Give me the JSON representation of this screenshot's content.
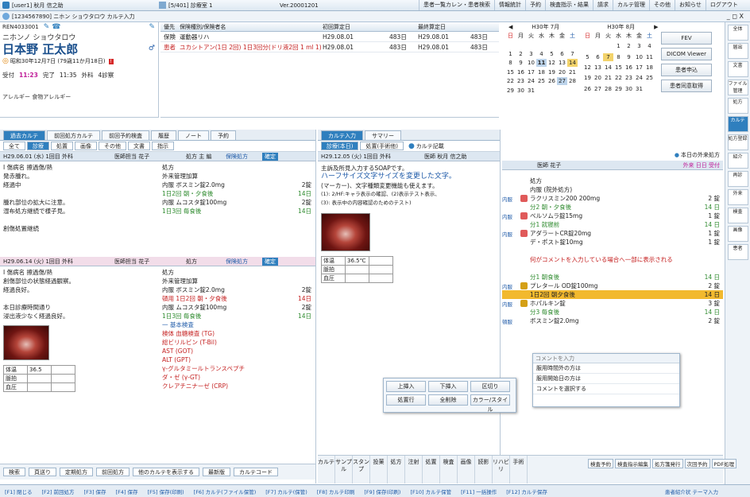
{
  "topbar": {
    "user": "[user1] 秋月 信之助",
    "dept": "[5/401] 診療室 1",
    "version": "Ver.20001201",
    "buttons": [
      "患者一覧カレン・患者検索",
      "情報統計",
      "予約",
      "検査指示・結果",
      "請求",
      "カルテ管理",
      "その他",
      "お知らせ",
      "ログアウト"
    ]
  },
  "subbar": {
    "patient_tab": "[1234567890] ニホン ショウタロウ カルテ入力",
    "win": "_ ◻ X"
  },
  "patient": {
    "id": "REN4033001",
    "kana": "ニホンノ ショウタロウ",
    "name": "日本野 正太郎",
    "birth": "昭和30年12月7日 (79歳11か月18日)",
    "visit_label": "受付",
    "visit_time": "11:23",
    "done_label": "完了",
    "done_time": "11:35",
    "dept_label": "外科",
    "dept_val": "4診察",
    "allergy": "アレルギー 食物アレルギー"
  },
  "insurance": {
    "headers": [
      "優先",
      "保険種別/保険者名",
      "初回算定日",
      "最終算定日"
    ],
    "rows": [
      {
        "type": "保険",
        "name": "運動器リハ",
        "start": "H29.08.01",
        "amt1": "483日",
        "end": "H29.08.01",
        "amt2": "483日"
      },
      {
        "type": "患者",
        "name": "ユカシトアン(1日 2回)  1日3回分(ドリ液2回 1 ml 1)",
        "start": "H29.08.01",
        "amt1": "483日",
        "end": "H29.08.01",
        "amt2": "483日"
      }
    ]
  },
  "calendar": {
    "month1": "H30年 7月",
    "month2": "H30年 8月",
    "weekdays": [
      "日",
      "月",
      "火",
      "水",
      "木",
      "金",
      "土"
    ],
    "days1": [
      "",
      "",
      "",
      "",
      "",
      "",
      "",
      "1",
      "2",
      "3",
      "4",
      "5",
      "6",
      "7",
      "8",
      "9",
      "10",
      "11",
      "12",
      "13",
      "14",
      "15",
      "16",
      "17",
      "18",
      "19",
      "20",
      "21",
      "22",
      "23",
      "24",
      "25",
      "26",
      "27",
      "28",
      "29",
      "30",
      "31"
    ],
    "days2": [
      "",
      "",
      "",
      "1",
      "2",
      "3",
      "4",
      "5",
      "6",
      "7",
      "8",
      "9",
      "10",
      "11",
      "12",
      "13",
      "14",
      "15",
      "16",
      "17",
      "18",
      "19",
      "20",
      "21",
      "22",
      "23",
      "24",
      "25",
      "26",
      "27",
      "28",
      "29",
      "30",
      "31"
    ],
    "side_buttons": [
      "FEV",
      "DICOM Viewer",
      "患者申込",
      "患者同意取得"
    ]
  },
  "rside": {
    "items": [
      "全体",
      "届出",
      "文書",
      "ファイル管理",
      "処方",
      "カルテ",
      "処方登録",
      "紹介",
      "再診",
      "外来",
      "検査",
      "画像",
      "患者"
    ]
  },
  "left": {
    "tabs": [
      "過去カルテ",
      "前回処方カルテ",
      "前回予約検査",
      "履歴",
      "ノート",
      "予約"
    ],
    "subtabs": [
      "全て",
      "診療",
      "処置",
      "画像",
      "その他",
      "文書",
      "指示"
    ],
    "rec1": {
      "header": "H29.06.01 (水)  1回目  外科",
      "doctor": "医師担当 花子",
      "kind": "処方 主 編",
      "status": "保険処方",
      "tag": "確定"
    },
    "rec1_left": [
      "I 傷病名  擦過傷/熱",
      "発赤腫れ。",
      "経過中",
      "",
      "腫れ部位の拡大に注意。",
      "湿布処方継続で様子見。",
      "",
      "創傷処置継続"
    ],
    "rec1_right": [
      {
        "t": "処方",
        "c": ""
      },
      {
        "t": "外来管理加算",
        "c": ""
      },
      {
        "t": "内服 ボスミン錠2.0mg",
        "c": "",
        "q": "2錠"
      },
      {
        "t": "1日2回 朝・夕食後",
        "c": "gr",
        "q": "14日"
      },
      {
        "t": "内服 ムコスタ錠100mg",
        "c": "",
        "q": "2錠"
      },
      {
        "t": "1日3回 毎食後",
        "c": "gr",
        "q": "14日"
      }
    ],
    "rec2": {
      "header": "H29.06.14 (火)  1回目  外科",
      "doctor": "医師担当 花子",
      "kind": "処方",
      "status": "保険処方",
      "tag": "確定"
    },
    "rec2_left": [
      "I 傷病名  擦過傷/熱",
      "創傷部位の状態経過観察。",
      "経過良好。",
      "",
      "本日診療時間通り",
      "浸出液少なく経過良好。"
    ],
    "rec2_right": [
      {
        "t": "処方",
        "c": ""
      },
      {
        "t": "外来管理加算",
        "c": ""
      },
      {
        "t": "内服 ボスミン錠2.0mg",
        "c": "",
        "q": "2錠"
      },
      {
        "t": "頓用 1日2回 朝・夕食後",
        "c": "rx",
        "q": "14日"
      },
      {
        "t": "内服 ムコスタ錠100mg",
        "c": "",
        "q": "2錠"
      },
      {
        "t": "1日3回 毎食後",
        "c": "gr",
        "q": "14日"
      },
      {
        "t": "一 基本検査",
        "c": "bl"
      },
      {
        "t": "検体 血糖検査 (TG)",
        "c": "rx"
      },
      {
        "t": "総ビリルビン (T-Bil)",
        "c": "rx"
      },
      {
        "t": "AST (GOT)",
        "c": "rx"
      },
      {
        "t": "ALT (GPT)",
        "c": "rx"
      },
      {
        "t": "γ-グルタミールトランスペプチ",
        "c": "rx"
      },
      {
        "t": "ダ・ゼ (γ-GT)",
        "c": "rx"
      },
      {
        "t": "クレアチニナーゼ (CRP)",
        "c": "rx"
      }
    ],
    "vitals": [
      "体温",
      "脈拍",
      "血圧"
    ],
    "vitals_val": [
      "36.5",
      "",
      ""
    ],
    "bottom": [
      "検索",
      "頁送り",
      "定期処方",
      "前回処方",
      "他のカルテを表示する",
      "最新版",
      "カルテコード"
    ],
    "page": "▼"
  },
  "mid": {
    "tabs": [
      "カルテ入力",
      "サマリー"
    ],
    "subtabs": [
      "診療(本日)",
      "処置(手術他)"
    ],
    "cond": "カルテ記載",
    "header": "H29.12.05 (火)  1回目  外科",
    "doctor": "医師 秋月 信之助",
    "lines": [
      "主訴及所見入力するSOAPです。",
      "ハーフサイズ文字サイズを変更した文字。",
      "(マーカー)、文字種類変更機能も使えます。",
      "(1): 2/HF:キャラ表示の確認、(2)表示テスト表示、",
      "(3): 表示中の内容確認のためのテスト)"
    ],
    "vitals": [
      "体温",
      "脈拍",
      "血圧"
    ],
    "vitals_val": [
      "36.5℃",
      "",
      ""
    ],
    "popup_buttons": [
      "上挿入",
      "下挿入",
      "区切り",
      "処置行",
      "全削除",
      "カラー/スタイル"
    ],
    "bottom_tools": [
      "カルテ",
      "サンプル",
      "スタンプ",
      "投薬",
      "処方",
      "注射",
      "処置",
      "検査",
      "画像",
      "読影",
      "リハビリ",
      "手術"
    ]
  },
  "order": {
    "header": "本日の外来処方",
    "doctor": "医師 花子",
    "time": "外来 日日 受付",
    "items": [
      {
        "kind": "",
        "badge": "",
        "text": "処方",
        "qty": "",
        "c": ""
      },
      {
        "kind": "",
        "badge": "",
        "text": "内服 (院外処方)",
        "qty": "",
        "c": ""
      },
      {
        "kind": "内服",
        "badge": "#e05a5a",
        "text": "ラクリスミン200 200mg",
        "qty": "2 錠",
        "c": ""
      },
      {
        "kind": "",
        "badge": "",
        "text": "分2 朝・夕食後",
        "qty": "14 日",
        "c": "gr"
      },
      {
        "kind": "内服",
        "badge": "#e05a5a",
        "text": "ベルソムラ錠15mg",
        "qty": "1 錠",
        "c": ""
      },
      {
        "kind": "",
        "badge": "",
        "text": "分1 就寝前",
        "qty": "14 日",
        "c": "gr"
      },
      {
        "kind": "内服",
        "badge": "#e05a5a",
        "text": "アダラートCR錠20mg",
        "qty": "1 錠",
        "c": ""
      },
      {
        "kind": "",
        "badge": "",
        "text": "デ・ポスト錠10mg",
        "qty": "1 錠",
        "c": ""
      },
      {
        "kind": "",
        "badge": "",
        "text": "",
        "qty": "",
        "c": ""
      },
      {
        "kind": "",
        "badge": "",
        "text": "何がコメントを入力している場合へ一部に表示される",
        "qty": "",
        "c": "rx"
      },
      {
        "kind": "",
        "badge": "",
        "text": "",
        "qty": "",
        "c": ""
      },
      {
        "kind": "",
        "badge": "",
        "text": "分1 朝食後",
        "qty": "14 日",
        "c": "gr"
      },
      {
        "kind": "内服",
        "badge": "#d4a017",
        "text": "プレタール OD錠100mg",
        "qty": "2 錠",
        "c": ""
      },
      {
        "kind": "",
        "badge": "",
        "text": "1日2回 朝夕食後",
        "qty": "14 日",
        "c": "hl"
      },
      {
        "kind": "内服",
        "badge": "#d4a017",
        "text": "ホパルキン錠",
        "qty": "3 錠",
        "c": ""
      },
      {
        "kind": "",
        "badge": "",
        "text": "分3 毎食後",
        "qty": "14 日",
        "c": "gr"
      },
      {
        "kind": "頓服",
        "badge": "",
        "text": "ボスミン錠2.0mg",
        "qty": "2 錠",
        "c": ""
      }
    ],
    "comment_placeholder": "コメントを入力",
    "comment_items": [
      "服用時間外の方は",
      "服用開始日の方は",
      "コメントを選択する"
    ],
    "bottom": [
      "検査予約",
      "検査指示編集",
      "処方箋発行",
      "次回予約",
      "PDF処理"
    ]
  },
  "footer": {
    "keys": [
      "[F1] 閉じる",
      "[F2] 前回処方",
      "[F3] 保存",
      "[F4] 保存",
      "[F5] 保存(印刷)",
      "[F6] カルテ(ファイル保管)",
      "[F7] カルテ(保管)",
      "[F8] カルテ印刷",
      "[F9] 保存(印刷)",
      "[F10] カルテ保管",
      "[F11] 一括操作",
      "[F12] カルテ保存"
    ],
    "status": "患者紹介状 テーマ入力"
  }
}
